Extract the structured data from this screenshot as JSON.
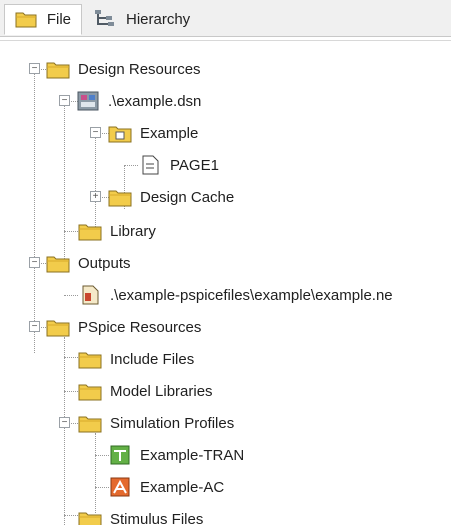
{
  "tabs": [
    {
      "label": "File",
      "icon": "folder-icon",
      "active": true
    },
    {
      "label": "Hierarchy",
      "icon": "hierarchy-icon",
      "active": false
    }
  ],
  "tree": {
    "design_resources": "Design Resources",
    "dsn_file": ".\\example.dsn",
    "example_folder": "Example",
    "page1": "PAGE1",
    "design_cache": "Design Cache",
    "library": "Library",
    "outputs": "Outputs",
    "netlist_file": ".\\example-pspicefiles\\example\\example.ne",
    "pspice_resources": "PSpice Resources",
    "include_files": "Include Files",
    "model_libraries": "Model Libraries",
    "simulation_profiles": "Simulation Profiles",
    "profile_tran": "Example-TRAN",
    "profile_ac": "Example-AC",
    "stimulus_files": "Stimulus Files"
  },
  "colors": {
    "folder": "#f2cc4b",
    "folder_outline": "#8a7020",
    "tran_icon": "#63b046",
    "ac_icon": "#e46a2e"
  }
}
